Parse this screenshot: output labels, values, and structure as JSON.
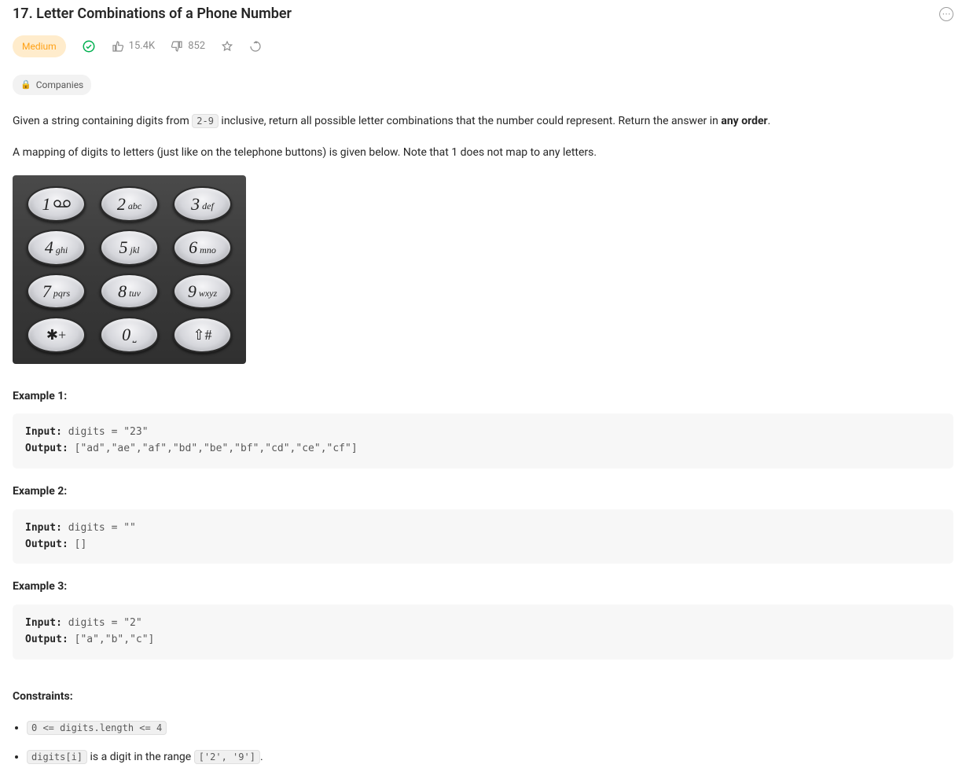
{
  "problem": {
    "number": "17.",
    "title": "Letter Combinations of a Phone Number",
    "difficulty": "Medium",
    "likes": "15.4K",
    "dislikes": "852",
    "companies_label": "Companies"
  },
  "description": {
    "p1_pre": "Given a string containing digits from ",
    "p1_code": "2-9",
    "p1_mid": " inclusive, return all possible letter combinations that the number could represent. Return the answer in ",
    "p1_bold": "any order",
    "p1_post": ".",
    "p2": "A mapping of digits to letters (just like on the telephone buttons) is given below. Note that 1 does not map to any letters."
  },
  "keypad": [
    {
      "num": "1",
      "letters": "",
      "sym": "voicemail"
    },
    {
      "num": "2",
      "letters": "abc"
    },
    {
      "num": "3",
      "letters": "def"
    },
    {
      "num": "4",
      "letters": "ghi"
    },
    {
      "num": "5",
      "letters": "jkl"
    },
    {
      "num": "6",
      "letters": "mno"
    },
    {
      "num": "7",
      "letters": "pqrs"
    },
    {
      "num": "8",
      "letters": "tuv"
    },
    {
      "num": "9",
      "letters": "wxyz"
    },
    {
      "sym": "✱+"
    },
    {
      "num": "0",
      "letters": "⎵"
    },
    {
      "sym": "⇧#"
    }
  ],
  "examples": [
    {
      "heading": "Example 1:",
      "input_label": "Input:",
      "input": " digits = \"23\"",
      "output_label": "Output:",
      "output": " [\"ad\",\"ae\",\"af\",\"bd\",\"be\",\"bf\",\"cd\",\"ce\",\"cf\"]"
    },
    {
      "heading": "Example 2:",
      "input_label": "Input:",
      "input": " digits = \"\"",
      "output_label": "Output:",
      "output": " []"
    },
    {
      "heading": "Example 3:",
      "input_label": "Input:",
      "input": " digits = \"2\"",
      "output_label": "Output:",
      "output": " [\"a\",\"b\",\"c\"]"
    }
  ],
  "constraints": {
    "heading": "Constraints:",
    "items": [
      {
        "type": "code",
        "text": "0 <= digits.length <= 4"
      },
      {
        "type": "mixed",
        "code1": "digits[i]",
        "mid": " is a digit in the range ",
        "code2": "['2', '9']",
        "post": "."
      }
    ]
  }
}
